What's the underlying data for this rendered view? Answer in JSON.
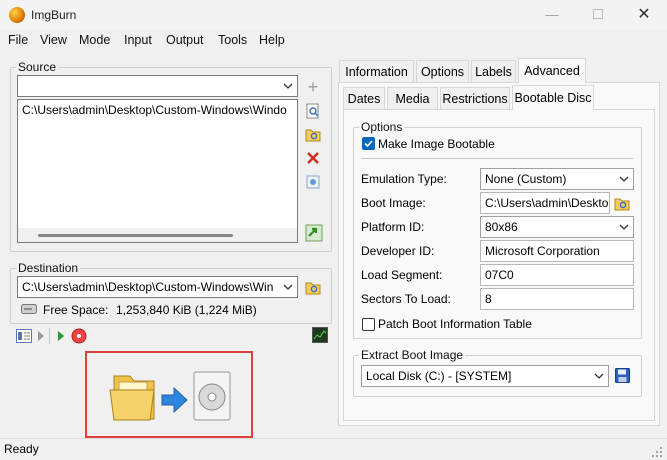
{
  "window": {
    "title": "ImgBurn"
  },
  "menu": [
    "File",
    "View",
    "Mode",
    "Input",
    "Output",
    "Tools",
    "Help"
  ],
  "source": {
    "label": "Source",
    "selected": "",
    "list_items": [
      "C:\\Users\\admin\\Desktop\\Custom-Windows\\Windo"
    ]
  },
  "destination": {
    "label": "Destination",
    "path": "C:\\Users\\admin\\Desktop\\Custom-Windows\\Win",
    "free_space_label": "Free Space:",
    "free_space_value": "1,253,840 KiB  (1,224 MiB)"
  },
  "tabs_top": [
    "Information",
    "Options",
    "Labels",
    "Advanced"
  ],
  "tabs_sub": [
    "Dates",
    "Media",
    "Restrictions",
    "Bootable Disc"
  ],
  "options": {
    "group_label": "Options",
    "make_bootable_label": "Make Image Bootable",
    "make_bootable_checked": true,
    "emulation_type_label": "Emulation Type:",
    "emulation_type_value": "None (Custom)",
    "boot_image_label": "Boot Image:",
    "boot_image_value": "C:\\Users\\admin\\Deskto",
    "platform_id_label": "Platform ID:",
    "platform_id_value": "80x86",
    "developer_id_label": "Developer ID:",
    "developer_id_value": "Microsoft Corporation",
    "load_segment_label": "Load Segment:",
    "load_segment_value": "07C0",
    "sectors_to_load_label": "Sectors To Load:",
    "sectors_to_load_value": "8",
    "patch_label": "Patch Boot Information Table",
    "patch_checked": false
  },
  "extract": {
    "group_label": "Extract Boot Image",
    "drive_value": "Local Disk (C:) - [SYSTEM]"
  },
  "status": {
    "text": "Ready"
  },
  "colors": {
    "accent": "#0067c0",
    "highlight_box": "#e0403a"
  }
}
